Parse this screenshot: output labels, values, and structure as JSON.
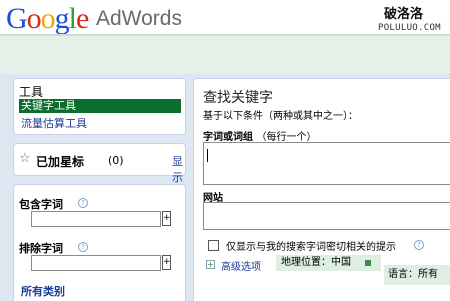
{
  "header": {
    "logo_letters": [
      "G",
      "o",
      "o",
      "g",
      "l",
      "e"
    ],
    "product": "AdWords",
    "watermark": "破洛洛",
    "watermark_sub": "POLULUO.COM"
  },
  "tools": {
    "title": "工具",
    "items": [
      {
        "label": "关键字工具",
        "selected": true
      },
      {
        "label": "流量估算工具",
        "selected": false
      }
    ]
  },
  "starred": {
    "label": "已加星标",
    "count": "(0)",
    "show_link": "显示"
  },
  "filters": {
    "include_label": "包含字词",
    "exclude_label": "排除字词",
    "help_glyph": "?",
    "add_glyph": "+",
    "all_categories": "所有类别"
  },
  "main": {
    "title": "查找关键字",
    "subtitle": "基于以下条件（两种或其中之一）：",
    "keyword_label": "字词或词组",
    "keyword_note": "（每行一个）",
    "keyword_value": "",
    "website_label": "网站",
    "website_value": "",
    "checkbox_label": "仅显示与我的搜索字词密切相关的提示",
    "help_glyph": "?",
    "expand_glyph": "+",
    "advanced_label": "高级选项",
    "location_label": "地理位置：中国",
    "language_label": "语言：所有"
  },
  "colors": {
    "selected_bg": "#0b6d2e",
    "link": "#1a3c9a",
    "band_bg": "#dde6f1",
    "header_bar": "#e5f0e8"
  }
}
